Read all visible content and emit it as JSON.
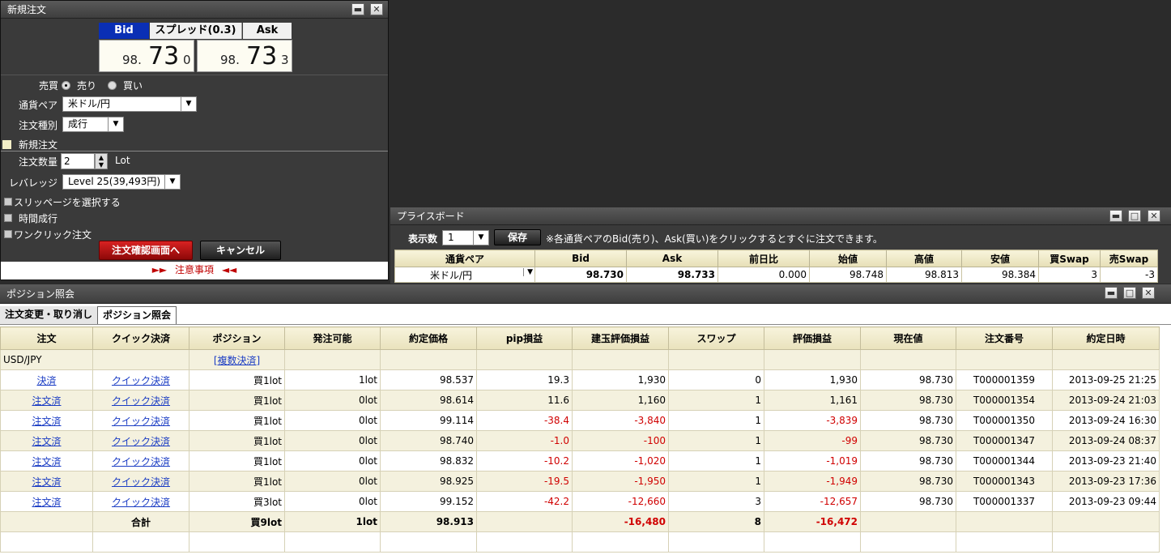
{
  "order_panel": {
    "title": "新規注文",
    "bid_label": "Bid",
    "spread_label": "スプレッド(0.3)",
    "ask_label": "Ask",
    "bid_price": {
      "prefix": "98.",
      "big": "73",
      "small": "0"
    },
    "ask_price": {
      "prefix": "98.",
      "big": "73",
      "small": "3"
    },
    "side_label": "売買",
    "sell_label": "売り",
    "buy_label": "買い",
    "pair_label": "通貨ペア",
    "pair_value": "米ドル/円",
    "order_type_label": "注文種別",
    "order_type_value": "成行",
    "new_order_label": "新規注文",
    "qty_label": "注文数量",
    "qty_value": "2",
    "qty_unit": "Lot",
    "leverage_label": "レバレッジ",
    "leverage_value": "Level 25(39,493円)",
    "slippage_label": "スリッページを選択する",
    "timed_label": "時間成行",
    "oneclick_label": "ワンクリック注文",
    "confirm_button": "注文確認画面へ",
    "cancel_button": "キャンセル",
    "notice": "注意事項",
    "notice_left": "►►",
    "notice_right": "◄◄"
  },
  "price_board": {
    "title": "プライスボード",
    "display_label": "表示数",
    "display_value": "1",
    "save_button": "保存",
    "hint": "※各通貨ペアのBid(売り)、Ask(買い)をクリックするとすぐに注文できます。",
    "headers": [
      "通貨ペア",
      "Bid",
      "Ask",
      "前日比",
      "始値",
      "高値",
      "安値",
      "買Swap",
      "売Swap"
    ],
    "row": [
      "米ドル/円",
      "98.730",
      "98.733",
      "0.000",
      "98.748",
      "98.813",
      "98.384",
      "3",
      "-3"
    ]
  },
  "position_panel": {
    "title": "ポジション照会",
    "tabs": [
      "注文変更・取り消し",
      "ポジション照会"
    ],
    "headers": [
      "注文",
      "クイック決済",
      "ポジション",
      "発注可能",
      "約定価格",
      "pip損益",
      "建玉評価損益",
      "スワップ",
      "評価損益",
      "現在値",
      "注文番号",
      "約定日時"
    ],
    "group_row": {
      "pair": "USD/JPY",
      "multi": "[複数決済]"
    },
    "rows": [
      [
        "決済",
        "クイック決済",
        "買1lot",
        "1lot",
        "98.537",
        "19.3",
        "1,930",
        "0",
        "1,930",
        "98.730",
        "T000001359",
        "2013-09-25 21:25"
      ],
      [
        "注文済",
        "クイック決済",
        "買1lot",
        "0lot",
        "98.614",
        "11.6",
        "1,160",
        "1",
        "1,161",
        "98.730",
        "T000001354",
        "2013-09-24 21:03"
      ],
      [
        "注文済",
        "クイック決済",
        "買1lot",
        "0lot",
        "99.114",
        "-38.4",
        "-3,840",
        "1",
        "-3,839",
        "98.730",
        "T000001350",
        "2013-09-24 16:30"
      ],
      [
        "注文済",
        "クイック決済",
        "買1lot",
        "0lot",
        "98.740",
        "-1.0",
        "-100",
        "1",
        "-99",
        "98.730",
        "T000001347",
        "2013-09-24 08:37"
      ],
      [
        "注文済",
        "クイック決済",
        "買1lot",
        "0lot",
        "98.832",
        "-10.2",
        "-1,020",
        "1",
        "-1,019",
        "98.730",
        "T000001344",
        "2013-09-23 21:40"
      ],
      [
        "注文済",
        "クイック決済",
        "買1lot",
        "0lot",
        "98.925",
        "-19.5",
        "-1,950",
        "1",
        "-1,949",
        "98.730",
        "T000001343",
        "2013-09-23 17:36"
      ],
      [
        "注文済",
        "クイック決済",
        "買3lot",
        "0lot",
        "99.152",
        "-42.2",
        "-12,660",
        "3",
        "-12,657",
        "98.730",
        "T000001337",
        "2013-09-23 09:44"
      ]
    ],
    "total_row": [
      "",
      "合計",
      "買9lot",
      "1lot",
      "98.913",
      "",
      "-16,480",
      "8",
      "-16,472",
      "",
      "",
      ""
    ]
  },
  "colors": {
    "negative": "#d00000",
    "link": "#1a3cc4",
    "confirm": "#b01010",
    "bid_head": "#0a2fb5"
  }
}
